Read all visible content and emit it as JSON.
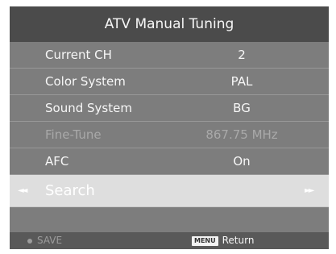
{
  "header": {
    "title": "ATV Manual Tuning"
  },
  "menu": {
    "items": [
      {
        "label": "Current CH",
        "value": "2",
        "state": "normal"
      },
      {
        "label": "Color System",
        "value": "PAL",
        "state": "normal"
      },
      {
        "label": "Sound System",
        "value": "BG",
        "state": "normal"
      },
      {
        "label": "Fine-Tune",
        "value": "867.75 MHz",
        "state": "disabled"
      },
      {
        "label": "AFC",
        "value": "On",
        "state": "normal"
      },
      {
        "label": "Search",
        "value": "",
        "state": "selected"
      }
    ],
    "search_left_arrow": "◄◄",
    "search_right_arrow": "►►"
  },
  "footer": {
    "save_label": "SAVE",
    "menu_key_label": "MENU",
    "return_label": "Return"
  },
  "colors": {
    "screen_background": "#7f7f7f",
    "title_background": "#4b4b4b",
    "selected_background": "#dedede",
    "footer_background": "#595959"
  }
}
